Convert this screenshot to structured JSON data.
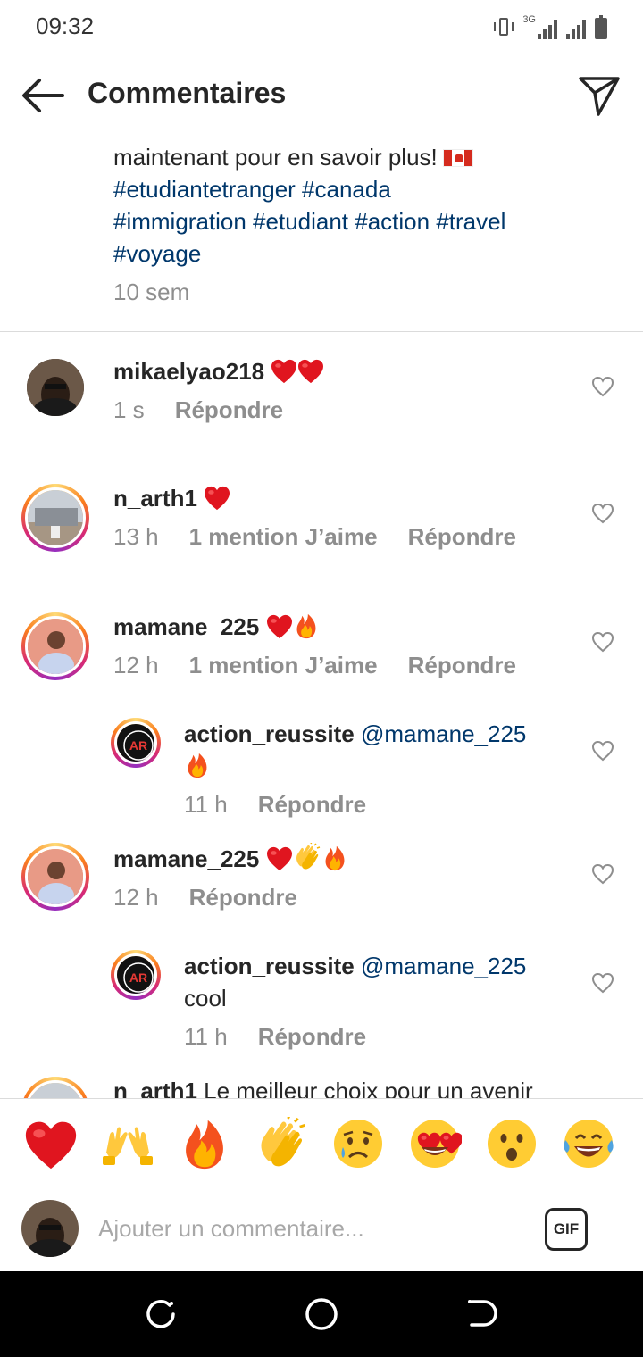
{
  "status_bar": {
    "time": "09:32",
    "network": "3G"
  },
  "header": {
    "title": "Commentaires"
  },
  "caption": {
    "text": "maintenant pour en savoir plus!",
    "tags_line1": "#etudiantetranger #canada",
    "tags_line2": "#immigration #etudiant #action #travel",
    "tags_line3": "#voyage",
    "time": "10 sem"
  },
  "comments": [
    {
      "user": "mikaelyao218",
      "time": "1 s",
      "reply": "Répondre"
    },
    {
      "user": "n_arth1",
      "time": "13 h",
      "likes": "1 mention J’aime",
      "reply": "Répondre"
    },
    {
      "user": "mamane_225",
      "time": "12 h",
      "likes": "1 mention J’aime",
      "reply": "Répondre"
    },
    {
      "user": "action_reussite",
      "mention": "@mamane_225",
      "time": "11 h",
      "reply": "Répondre"
    },
    {
      "user": "mamane_225",
      "time": "12 h",
      "reply": "Répondre"
    },
    {
      "user": "action_reussite",
      "mention": "@mamane_225",
      "text": "cool",
      "time": "11 h",
      "reply": "Répondre"
    },
    {
      "user": "n_arth1",
      "text": "Le meilleur choix pour un avenir"
    }
  ],
  "quick_emojis": [
    "red-heart",
    "raising-hands",
    "fire",
    "clapping-hands",
    "sad-face",
    "heart-eyes",
    "surprised-face",
    "tears-of-joy"
  ],
  "composer": {
    "placeholder": "Ajouter un commentaire...",
    "gif_label": "GIF"
  }
}
